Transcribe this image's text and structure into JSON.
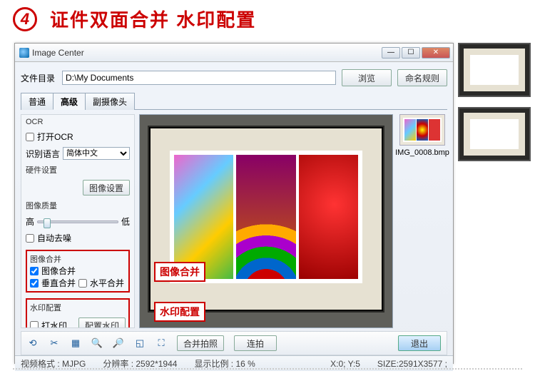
{
  "header": {
    "number": "4",
    "title": "证件双面合并 水印配置"
  },
  "window": {
    "title": "Image Center",
    "file_label": "文件目录",
    "file_path": "D:\\My Documents",
    "browse": "浏览",
    "naming": "命名规则",
    "tabs": [
      "普通",
      "高级",
      "副摄像头"
    ],
    "active_tab": 1
  },
  "panel": {
    "ocr_title": "OCR",
    "open_ocr": "打开OCR",
    "lang_label": "识别语言",
    "lang_value": "简体中文",
    "hw_title": "硬件设置",
    "img_set": "图像设置",
    "quality_title": "图像质量",
    "quality_hi": "高",
    "quality_lo": "低",
    "auto_despeckle": "自动去噪",
    "merge_title": "图像合并",
    "merge_enable": "图像合并",
    "merge_v": "垂直合并",
    "merge_h": "水平合并",
    "wm_title": "水印配置",
    "wm_enable": "打水印",
    "wm_cfg": "配置水印"
  },
  "callouts": {
    "merge": "图像合并",
    "watermark": "水印配置"
  },
  "thumb": {
    "name": "IMG_0008.bmp"
  },
  "toolbar": {
    "merge_shoot": "合并拍照",
    "burst": "连拍",
    "exit": "退出"
  },
  "status": {
    "fmt_l": "视频格式 :",
    "fmt_v": "MJPG",
    "res_l": "分辨率 :",
    "res_v": "2592*1944",
    "ratio_l": "显示比例 :",
    "ratio_v": "16 %",
    "xy": "X:0; Y:5",
    "size_l": "SIZE:",
    "size_v": "2591X3577 ;"
  }
}
